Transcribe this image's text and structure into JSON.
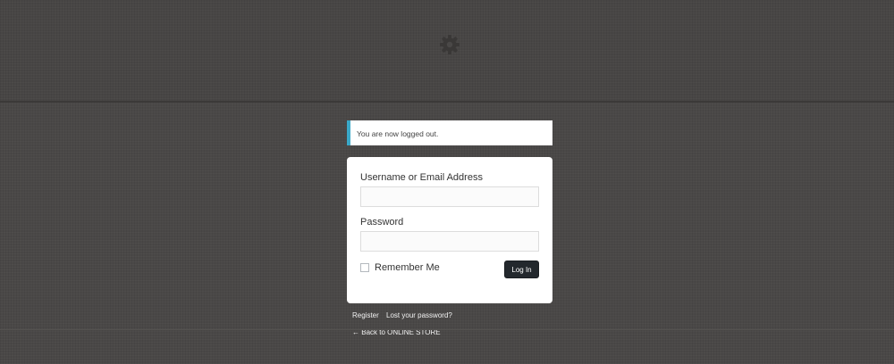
{
  "logo": {
    "icon": "gear-icon",
    "color": "#3a3837"
  },
  "notice": {
    "message": "You are now logged out.",
    "accent_color": "#3aa8c8"
  },
  "login_form": {
    "username_label": "Username or Email Address",
    "username_value": "",
    "password_label": "Password",
    "password_value": "",
    "remember_label": "Remember Me",
    "remember_checked": false,
    "submit_label": "Log In"
  },
  "nav": {
    "register_label": "Register",
    "lost_password_label": "Lost your password?",
    "back_arrow": "←",
    "back_label": "Back to ONLINE STORE"
  }
}
